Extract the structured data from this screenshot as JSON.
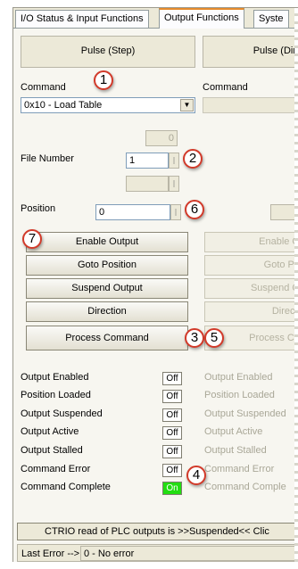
{
  "tabs": [
    "I/O Status & Input Functions",
    "Output Functions",
    "Syste"
  ],
  "columns": [
    {
      "header": "Pulse (Step)"
    },
    {
      "header": "Pulse (Dir"
    }
  ],
  "command": {
    "label": "Command",
    "value": "0x10 - Load Table",
    "label2": "Command"
  },
  "fields": {
    "top_disabled_value": "0",
    "file_number_label": "File Number",
    "file_number_value": "1",
    "position_label": "Position",
    "position_value": "0"
  },
  "buttons": {
    "enable_output": "Enable Output",
    "goto_position": "Goto Position",
    "suspend_output": "Suspend Output",
    "direction": "Direction",
    "process_command": "Process Command"
  },
  "buttons_col2": {
    "enable_output": "Enable O",
    "goto_position": "Goto Pu",
    "suspend_output": "Suspend O",
    "direction": "Directi",
    "process_command": "Process Co"
  },
  "status": [
    {
      "label": "Output Enabled",
      "value": "Off",
      "label2": "Output Enabled"
    },
    {
      "label": "Position Loaded",
      "value": "Off",
      "label2": "Position Loaded"
    },
    {
      "label": "Output Suspended",
      "value": "Off",
      "label2": "Output Suspended"
    },
    {
      "label": "Output Active",
      "value": "Off",
      "label2": "Output Active"
    },
    {
      "label": "Output Stalled",
      "value": "Off",
      "label2": "Output Stalled"
    },
    {
      "label": "Command Error",
      "value": "Off",
      "label2": "Command Error"
    },
    {
      "label": "Command Complete",
      "value": "On",
      "label2": "Command Comple"
    }
  ],
  "status_colors": {
    "on": "#22dd11",
    "off": "#ffffff"
  },
  "callouts": [
    "1",
    "2",
    "6",
    "7",
    "3",
    "5",
    "4"
  ],
  "footer": {
    "message": "CTRIO read of PLC outputs is >>Suspended<< Clic",
    "last_error_label": "Last Error -->",
    "last_error_value": "0 - No error"
  }
}
